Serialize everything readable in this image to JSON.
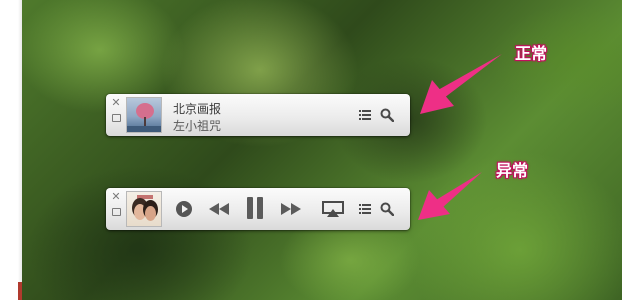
{
  "normal_player": {
    "close_glyph": "✕",
    "track_title": "北京画报",
    "track_artist": "左小祖咒",
    "icons": [
      "close-icon",
      "resize-icon",
      "album-cover",
      "playlist-icon",
      "search-icon"
    ]
  },
  "abnormal_player": {
    "close_glyph": "✕",
    "icons": [
      "close-icon",
      "resize-icon",
      "album-cover",
      "play-circle-icon",
      "rewind-icon",
      "pause-icon",
      "fast-forward-icon",
      "airplay-icon",
      "playlist-icon",
      "search-icon"
    ]
  },
  "annotations": {
    "normal_label": "正常",
    "abnormal_label": "异常",
    "arrow_color": "#ee2f86"
  },
  "colors": {
    "label_outline": "#c0105c",
    "control_gray": "#5b5b5b",
    "player_bg": "#ececec"
  }
}
